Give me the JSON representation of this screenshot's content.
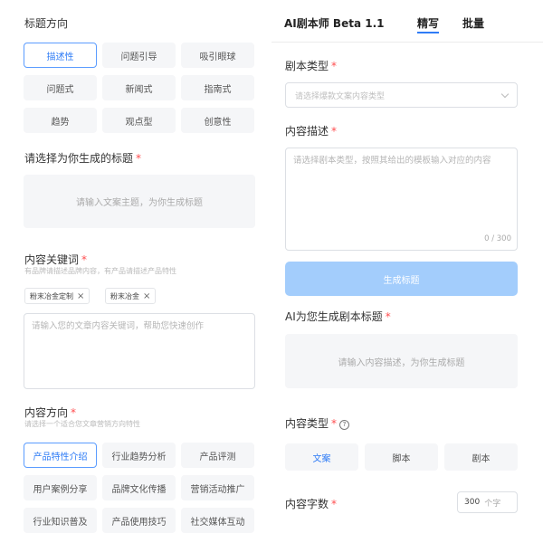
{
  "left": {
    "title_direction": {
      "label": "标题方向",
      "options": [
        "描述性",
        "问题引导",
        "吸引眼球",
        "问题式",
        "新闻式",
        "指南式",
        "趋势",
        "观点型",
        "创意性"
      ],
      "selected": "描述性"
    },
    "generated_title": {
      "label": "请选择为你生成的标题",
      "required_mark": "*",
      "placeholder": "请输入文案主题，为你生成标题"
    },
    "keywords": {
      "label": "内容关键词",
      "required_mark": "*",
      "hint": "有品牌请描述品牌内容，有产品请描述产品特性",
      "tags": [
        "粉末冶金定制",
        "粉末冶金"
      ],
      "tag_close": "×",
      "placeholder": "请输入您的文章内容关键词，帮助您快速创作"
    },
    "content_direction": {
      "label": "内容方向",
      "required_mark": "*",
      "hint": "请选择一个适合您文章营销方向特性",
      "options": [
        "产品特性介绍",
        "行业趋势分析",
        "产品评测",
        "用户案例分享",
        "品牌文化传播",
        "营销活动推广",
        "行业知识普及",
        "产品使用技巧",
        "社交媒体互动"
      ],
      "selected": "产品特性介绍"
    }
  },
  "right": {
    "app_title": "AI剧本师 Beta 1.1",
    "tabs": [
      "精写",
      "批量"
    ],
    "active_tab": "精写",
    "script_type": {
      "label": "剧本类型",
      "required_mark": "*",
      "placeholder": "请选择爆款文案内容类型"
    },
    "content_desc": {
      "label": "内容描述",
      "required_mark": "*",
      "placeholder": "请选择剧本类型，按照其给出的模板输入对应的内容",
      "counter": "0 / 300"
    },
    "generate_button": "生成标题",
    "ai_title": {
      "label": "AI为您生成剧本标题",
      "required_mark": "*",
      "placeholder": "请输入内容描述，为你生成标题"
    },
    "content_type": {
      "label": "内容类型",
      "required_mark": "*",
      "help_icon": "question-circle-icon",
      "help_glyph": "?",
      "options": [
        "文案",
        "脚本",
        "剧本"
      ],
      "selected": "文案"
    },
    "word_count": {
      "label": "内容字数",
      "required_mark": "*",
      "value": "300",
      "unit": "个字"
    }
  },
  "colors": {
    "accent": "#2f7cf6",
    "required": "#ff4d4f",
    "button_disabled": "#a3cdfc",
    "option_bg": "#f5f6f8"
  }
}
